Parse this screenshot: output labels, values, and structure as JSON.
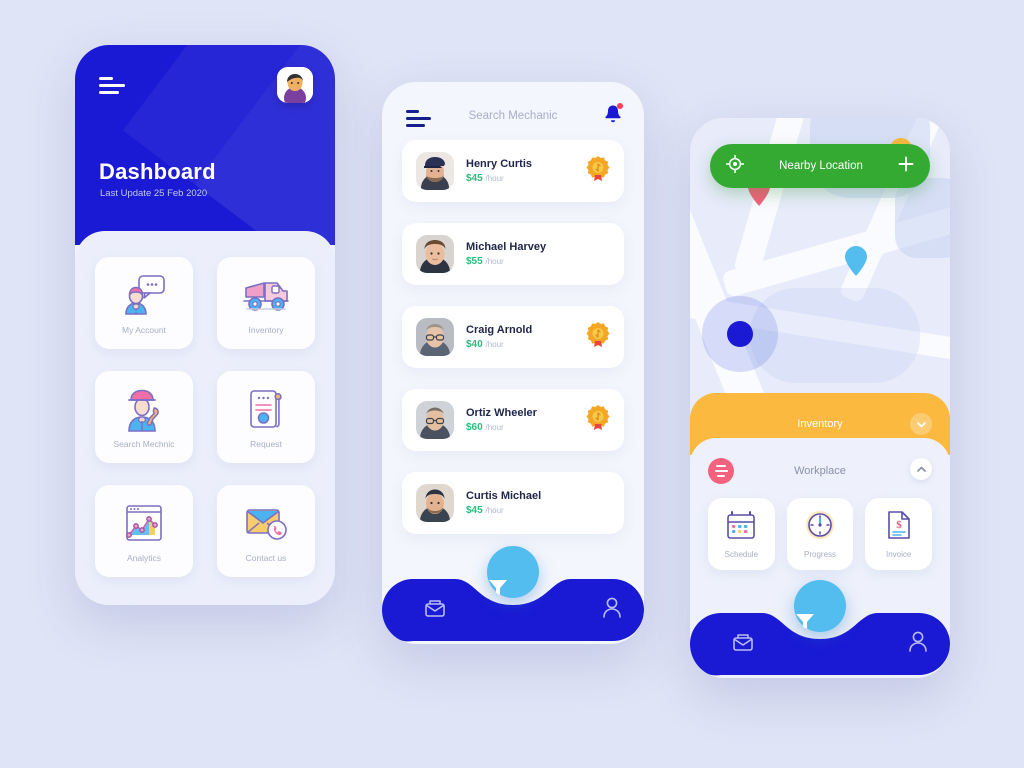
{
  "background_color": "#dfe4f6",
  "dashboard": {
    "menu_icon": "hamburger-icon",
    "avatar_icon": "user-avatar",
    "title": "Dashboard",
    "subtitle": "Last Update 25 Feb 2020",
    "header_color": "#1a1ad4",
    "tiles": [
      {
        "label": "My Account",
        "icon": "account-chat-icon"
      },
      {
        "label": "Inventory",
        "icon": "dump-truck-icon"
      },
      {
        "label": "Search Mechnic",
        "icon": "mechanic-wrench-icon"
      },
      {
        "label": "Request",
        "icon": "document-request-icon"
      },
      {
        "label": "Analytics",
        "icon": "chart-analytics-icon"
      },
      {
        "label": "Contact us",
        "icon": "envelope-phone-icon"
      }
    ]
  },
  "search_mechanic": {
    "menu_icon": "hamburger-icon",
    "title": "Search Mechanic",
    "notification_icon": "bell-icon",
    "has_notification": true,
    "rate_unit": "/hour",
    "mechanics": [
      {
        "name": "Henry Curtis",
        "rate": "$45",
        "badge": true
      },
      {
        "name": "Michael Harvey",
        "rate": "$55",
        "badge": false
      },
      {
        "name": "Craig Arnold",
        "rate": "$40",
        "badge": true
      },
      {
        "name": "Ortiz Wheeler",
        "rate": "$60",
        "badge": true
      },
      {
        "name": "Curtis Michael",
        "rate": "$45",
        "badge": false
      }
    ],
    "bottom_nav": {
      "mail_icon": "mail-icon",
      "profile_icon": "person-icon",
      "fab_icon": "filter-icon",
      "bar_color": "#1a1ad4",
      "fab_color": "#54bdf0"
    }
  },
  "map_screen": {
    "nearby": {
      "label": "Nearby Location",
      "locate_icon": "crosshair-icon",
      "add_icon": "plus-icon",
      "color": "#34aa33"
    },
    "pins": [
      {
        "name": "pin-pink",
        "color": "#f4627e"
      },
      {
        "name": "pin-orange",
        "color": "#fbb93f"
      },
      {
        "name": "pin-blue",
        "color": "#54bdf0"
      },
      {
        "name": "current-location-dot",
        "color": "#1a1ad4"
      }
    ],
    "inventory_panel": {
      "label": "Inventory",
      "color": "#fbb93f",
      "toggle_icon": "chevron-down-icon"
    },
    "workplace_panel": {
      "label": "Workplace",
      "menu_icon": "pink-menu-icon",
      "toggle_icon": "chevron-up-icon",
      "tiles": [
        {
          "label": "Schedule",
          "icon": "calendar-icon"
        },
        {
          "label": "Progress",
          "icon": "clock-gauge-icon"
        },
        {
          "label": "Invoice",
          "icon": "invoice-dollar-icon"
        }
      ]
    },
    "bottom_nav": {
      "mail_icon": "mail-icon",
      "profile_icon": "person-icon",
      "fab_icon": "filter-icon"
    }
  }
}
